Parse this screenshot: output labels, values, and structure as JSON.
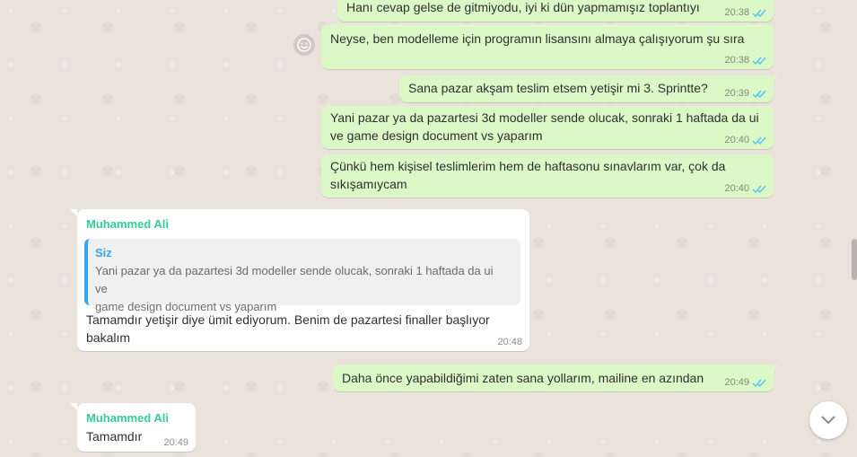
{
  "messages": [
    {
      "text": "Hanı cevap gelse de gitmiyodu, iyi ki dün yapmamışız toplantıyı",
      "time": "20:38"
    },
    {
      "text": "Neyse, ben modelleme için programın lisansını almaya çalışıyorum şu sıra",
      "time": "20:38"
    },
    {
      "text": "Sana pazar akşam teslim etsem yetişir mi 3. Sprintte?",
      "time": "20:39"
    },
    {
      "text_line1": "Yani pazar ya da pazartesi 3d modeller sende olucak, sonraki 1 haftada da ui",
      "text_line2": "ve game design document vs yaparım",
      "time": "20:40"
    },
    {
      "text_line1": "Çünkü hem kişisel teslimlerim hem de haftasonu sınavlarım var, çok da",
      "text_line2": "sıkışamıycam",
      "time": "20:40"
    },
    {
      "sender": "Muhammed Ali",
      "quote_sender": "Siz",
      "quote_line1": "Yani pazar ya da pazartesi 3d modeller sende olucak, sonraki 1 haftada da ui ve",
      "quote_line2": "game design document vs yaparım",
      "text_line1": "Tamamdır yetişir diye ümit ediyorum. Benim de pazartesi finaller başlıyor",
      "text_line2": "bakalım",
      "time": "20:48"
    },
    {
      "text": "Daha önce yapabildiğimi zaten sana yollarım, mailine en azından",
      "time": "20:49"
    },
    {
      "sender": "Muhammed Ali",
      "text": "Tamamdır",
      "time": "20:49"
    }
  ],
  "icons": {
    "read_receipt": "double-check-icon",
    "reaction": "smiley-icon",
    "scroll_down": "chevron-down-icon"
  },
  "colors": {
    "outgoing": "#dcf8c6",
    "incoming": "#ffffff",
    "sender_name": "#35cd96",
    "quote_bar": "#35a5f1",
    "tick": "#4fc3f7"
  }
}
